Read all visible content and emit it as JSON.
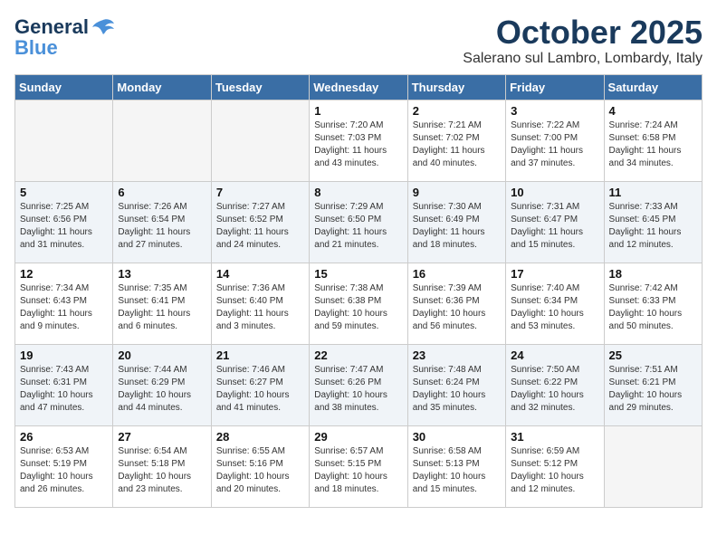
{
  "header": {
    "logo_general": "General",
    "logo_blue": "Blue",
    "month": "October 2025",
    "location": "Salerano sul Lambro, Lombardy, Italy"
  },
  "days_of_week": [
    "Sunday",
    "Monday",
    "Tuesday",
    "Wednesday",
    "Thursday",
    "Friday",
    "Saturday"
  ],
  "weeks": [
    [
      {
        "day": null
      },
      {
        "day": null
      },
      {
        "day": null
      },
      {
        "day": "1",
        "sunrise": "7:20 AM",
        "sunset": "7:03 PM",
        "daylight": "11 hours and 43 minutes."
      },
      {
        "day": "2",
        "sunrise": "7:21 AM",
        "sunset": "7:02 PM",
        "daylight": "11 hours and 40 minutes."
      },
      {
        "day": "3",
        "sunrise": "7:22 AM",
        "sunset": "7:00 PM",
        "daylight": "11 hours and 37 minutes."
      },
      {
        "day": "4",
        "sunrise": "7:24 AM",
        "sunset": "6:58 PM",
        "daylight": "11 hours and 34 minutes."
      }
    ],
    [
      {
        "day": "5",
        "sunrise": "7:25 AM",
        "sunset": "6:56 PM",
        "daylight": "11 hours and 31 minutes."
      },
      {
        "day": "6",
        "sunrise": "7:26 AM",
        "sunset": "6:54 PM",
        "daylight": "11 hours and 27 minutes."
      },
      {
        "day": "7",
        "sunrise": "7:27 AM",
        "sunset": "6:52 PM",
        "daylight": "11 hours and 24 minutes."
      },
      {
        "day": "8",
        "sunrise": "7:29 AM",
        "sunset": "6:50 PM",
        "daylight": "11 hours and 21 minutes."
      },
      {
        "day": "9",
        "sunrise": "7:30 AM",
        "sunset": "6:49 PM",
        "daylight": "11 hours and 18 minutes."
      },
      {
        "day": "10",
        "sunrise": "7:31 AM",
        "sunset": "6:47 PM",
        "daylight": "11 hours and 15 minutes."
      },
      {
        "day": "11",
        "sunrise": "7:33 AM",
        "sunset": "6:45 PM",
        "daylight": "11 hours and 12 minutes."
      }
    ],
    [
      {
        "day": "12",
        "sunrise": "7:34 AM",
        "sunset": "6:43 PM",
        "daylight": "11 hours and 9 minutes."
      },
      {
        "day": "13",
        "sunrise": "7:35 AM",
        "sunset": "6:41 PM",
        "daylight": "11 hours and 6 minutes."
      },
      {
        "day": "14",
        "sunrise": "7:36 AM",
        "sunset": "6:40 PM",
        "daylight": "11 hours and 3 minutes."
      },
      {
        "day": "15",
        "sunrise": "7:38 AM",
        "sunset": "6:38 PM",
        "daylight": "10 hours and 59 minutes."
      },
      {
        "day": "16",
        "sunrise": "7:39 AM",
        "sunset": "6:36 PM",
        "daylight": "10 hours and 56 minutes."
      },
      {
        "day": "17",
        "sunrise": "7:40 AM",
        "sunset": "6:34 PM",
        "daylight": "10 hours and 53 minutes."
      },
      {
        "day": "18",
        "sunrise": "7:42 AM",
        "sunset": "6:33 PM",
        "daylight": "10 hours and 50 minutes."
      }
    ],
    [
      {
        "day": "19",
        "sunrise": "7:43 AM",
        "sunset": "6:31 PM",
        "daylight": "10 hours and 47 minutes."
      },
      {
        "day": "20",
        "sunrise": "7:44 AM",
        "sunset": "6:29 PM",
        "daylight": "10 hours and 44 minutes."
      },
      {
        "day": "21",
        "sunrise": "7:46 AM",
        "sunset": "6:27 PM",
        "daylight": "10 hours and 41 minutes."
      },
      {
        "day": "22",
        "sunrise": "7:47 AM",
        "sunset": "6:26 PM",
        "daylight": "10 hours and 38 minutes."
      },
      {
        "day": "23",
        "sunrise": "7:48 AM",
        "sunset": "6:24 PM",
        "daylight": "10 hours and 35 minutes."
      },
      {
        "day": "24",
        "sunrise": "7:50 AM",
        "sunset": "6:22 PM",
        "daylight": "10 hours and 32 minutes."
      },
      {
        "day": "25",
        "sunrise": "7:51 AM",
        "sunset": "6:21 PM",
        "daylight": "10 hours and 29 minutes."
      }
    ],
    [
      {
        "day": "26",
        "sunrise": "6:53 AM",
        "sunset": "5:19 PM",
        "daylight": "10 hours and 26 minutes."
      },
      {
        "day": "27",
        "sunrise": "6:54 AM",
        "sunset": "5:18 PM",
        "daylight": "10 hours and 23 minutes."
      },
      {
        "day": "28",
        "sunrise": "6:55 AM",
        "sunset": "5:16 PM",
        "daylight": "10 hours and 20 minutes."
      },
      {
        "day": "29",
        "sunrise": "6:57 AM",
        "sunset": "5:15 PM",
        "daylight": "10 hours and 18 minutes."
      },
      {
        "day": "30",
        "sunrise": "6:58 AM",
        "sunset": "5:13 PM",
        "daylight": "10 hours and 15 minutes."
      },
      {
        "day": "31",
        "sunrise": "6:59 AM",
        "sunset": "5:12 PM",
        "daylight": "10 hours and 12 minutes."
      },
      {
        "day": null
      }
    ]
  ]
}
